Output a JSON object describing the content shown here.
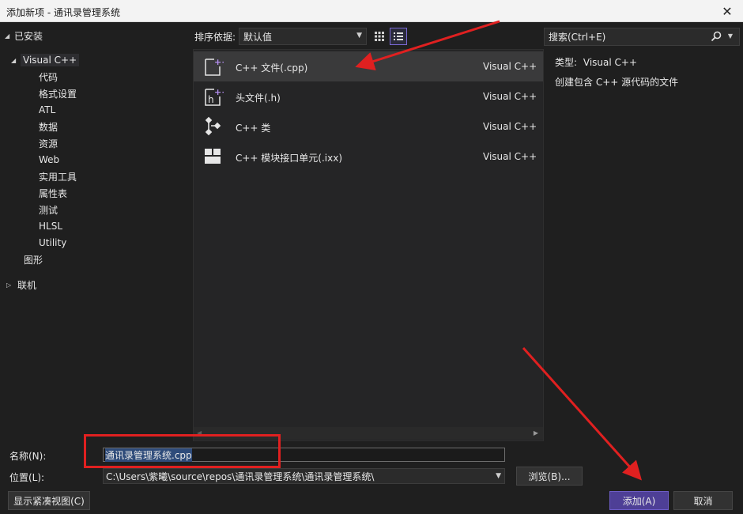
{
  "window": {
    "title": "添加新项 - 通讯录管理系统",
    "close_glyph": "✕"
  },
  "tree": {
    "installed": "已安装",
    "visual_cpp": "Visual C++",
    "children": [
      "代码",
      "格式设置",
      "ATL",
      "数据",
      "资源",
      "Web",
      "实用工具",
      "属性表",
      "测试",
      "HLSL",
      "Utility"
    ],
    "graphics": "图形",
    "online": "联机"
  },
  "toolbar": {
    "sort_label": "排序依据:",
    "sort_value": "默认值",
    "grid_view_icon": "grid-view-icon",
    "list_view_icon": "list-view-icon"
  },
  "search": {
    "placeholder": "搜索(Ctrl+E)",
    "icon": "search-icon"
  },
  "templates": [
    {
      "name": "C++ 文件(.cpp)",
      "language": "Visual C++",
      "icon": "cpp-file-icon",
      "selected": true
    },
    {
      "name": "头文件(.h)",
      "language": "Visual C++",
      "icon": "header-file-icon",
      "selected": false
    },
    {
      "name": "C++ 类",
      "language": "Visual C++",
      "icon": "cpp-class-icon",
      "selected": false
    },
    {
      "name": "C++ 模块接口单元(.ixx)",
      "language": "Visual C++",
      "icon": "module-interface-icon",
      "selected": false
    }
  ],
  "details": {
    "type_label": "类型:",
    "type_value": "Visual C++",
    "description": "创建包含 C++ 源代码的文件"
  },
  "form": {
    "name_label": "名称(N):",
    "name_value": "通讯录管理系统.cpp",
    "location_label": "位置(L):",
    "location_value": "C:\\Users\\紫曦\\source\\repos\\通讯录管理系统\\通讯录管理系统\\",
    "browse_label": "浏览(B)...",
    "compact_view_label": "显示紧凑视图(C)",
    "add_label": "添加(A)",
    "cancel_label": "取消"
  },
  "colors": {
    "background": "#1f1f1f",
    "accent": "#4e3f96",
    "annotation_red": "#e02020",
    "icon_purple": "#b48ef0"
  }
}
